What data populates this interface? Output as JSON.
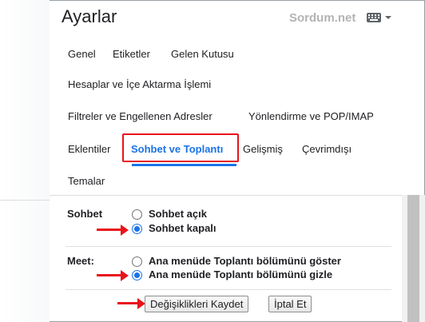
{
  "header": {
    "title": "Ayarlar",
    "watermark": "Sordum.net",
    "keyboard_icon": "keyboard-icon",
    "dropdown_icon": "caret-down-icon"
  },
  "tabs": {
    "general": "Genel",
    "labels": "Etiketler",
    "inbox": "Gelen Kutusu",
    "accounts": "Hesaplar ve İçe Aktarma İşlemi",
    "filters": "Filtreler ve Engellenen Adresler",
    "forwarding": "Yönlendirme ve POP/IMAP",
    "addons": "Eklentiler",
    "chat_meet": "Sohbet ve Toplantı",
    "advanced": "Gelişmiş",
    "offline": "Çevrimdışı",
    "themes": "Temalar",
    "active": "chat_meet"
  },
  "chat": {
    "label": "Sohbet",
    "option_on": "Sohbet açık",
    "option_off": "Sohbet kapalı",
    "selected": "off"
  },
  "meet": {
    "label": "Meet:",
    "option_show": "Ana menüde Toplantı bölümünü göster",
    "option_hide": "Ana menüde Toplantı bölümünü gizle",
    "selected": "hide"
  },
  "actions": {
    "save_label": "Değişiklikleri Kaydet",
    "cancel_label": "İptal Et"
  },
  "colors": {
    "accent": "#1a73e8",
    "annotation_red": "#e8141b"
  }
}
